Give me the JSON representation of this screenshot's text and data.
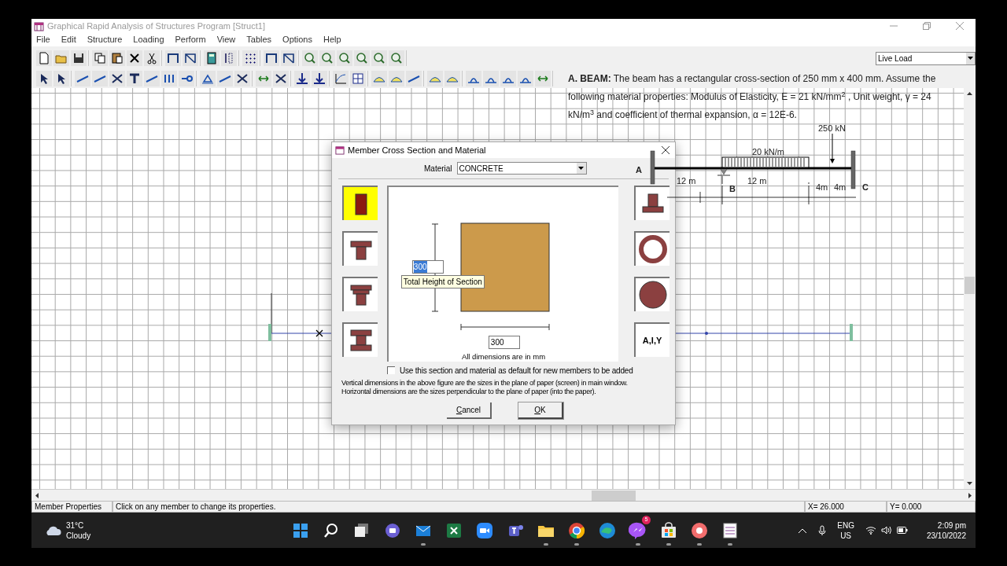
{
  "window": {
    "title": "Graphical Rapid Analysis of Structures Program [Struct1]"
  },
  "menu": [
    "File",
    "Edit",
    "Structure",
    "Loading",
    "Perform",
    "View",
    "Tables",
    "Options",
    "Help"
  ],
  "load_case": {
    "value": "Live Load"
  },
  "problem_note": {
    "text": "**A. BEAM:** The beam has a rectangular cross-section of 250 mm x 400 mm. Assume the following material properties: Modulus of Elasticity, E = 21 kN/mm$^{2}$ , Unit weight, γ = 24 kN/m$^{3}$ and coefficient of thermal expansion, α = 12E-6.",
    "labels": [
      "250 kN",
      "20 kN/m",
      "A",
      "12 m",
      "B",
      "12 m",
      "4m",
      "4m",
      "C"
    ]
  },
  "dialog": {
    "title": "Member Cross Section and Material",
    "material_label": "Material",
    "material": "CONCRETE",
    "sections_left": [
      {
        "kind": "rectangle",
        "selected": true
      },
      {
        "kind": "tee",
        "selected": false
      },
      {
        "kind": "stepped",
        "selected": false
      },
      {
        "kind": "ibeam",
        "selected": false
      }
    ],
    "sections_right": [
      {
        "kind": "inverted_tee",
        "selected": false
      },
      {
        "kind": "ring",
        "selected": false
      },
      {
        "kind": "circle",
        "selected": false
      },
      {
        "kind": "properties",
        "label": "A,I,Y",
        "selected": false
      }
    ],
    "height_value": "300",
    "tooltip": "Total Height of Section",
    "width_value": "300",
    "units_note": "All dimensions are in mm",
    "default_checkbox": {
      "label": "Use this section and material as default for new members to be added",
      "checked": false
    },
    "explanation": [
      "Vertical dimensions in the above figure are the sizes in the plane of paper (screen) in main window.",
      "Horizontal dimensions are the sizes perpendicular to the plane of paper (into the paper)."
    ],
    "buttons": [
      {
        "label": "Cancel",
        "kind": "cancel"
      },
      {
        "label": "OK",
        "kind": "ok"
      }
    ]
  },
  "status_bar": [
    "Member Properties",
    "Click on any member to change its properties.",
    "X= 26.000",
    "Y= 0.000"
  ],
  "taskbar": {
    "weather": {
      "temperature": "31°C",
      "condition": "Cloudy"
    },
    "apps": [
      {
        "kind": "start",
        "running": false
      },
      {
        "kind": "search",
        "running": false
      },
      {
        "kind": "taskview",
        "running": false
      },
      {
        "kind": "chat",
        "running": false
      },
      {
        "kind": "mail",
        "running": true
      },
      {
        "kind": "excel",
        "running": false
      },
      {
        "kind": "zoom",
        "running": false
      },
      {
        "kind": "teams",
        "running": false
      },
      {
        "kind": "folder",
        "running": true
      },
      {
        "kind": "chrome",
        "running": true
      },
      {
        "kind": "edge",
        "running": false
      },
      {
        "kind": "messenger",
        "running": true,
        "badge": "5"
      },
      {
        "kind": "store",
        "running": true
      },
      {
        "kind": "recorder",
        "running": true
      },
      {
        "kind": "app",
        "running": true
      }
    ],
    "language": [
      "ENG",
      "US"
    ],
    "time": "2:09 pm",
    "date": "23/10/2022"
  }
}
